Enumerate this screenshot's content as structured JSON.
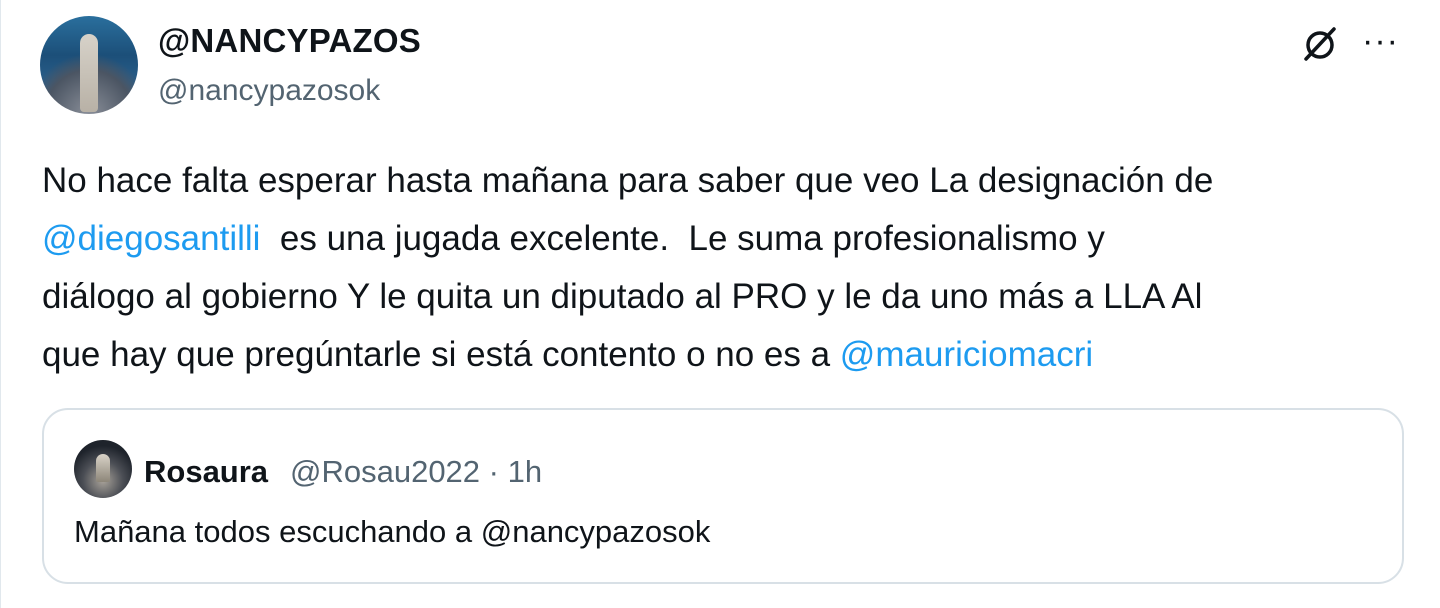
{
  "author": {
    "display_name": "@NANCYPAZOS",
    "handle": "@nancypazosok"
  },
  "icons": {
    "grok": "grok-slash-icon",
    "more": "more-options-icon",
    "more_glyph": "···"
  },
  "tweet": {
    "lines": [
      {
        "t1": "No hace falta esperar hasta mañana para saber que veo La designación de"
      },
      {
        "mention": "@diegosantilli",
        "t2": "  es una jugada excelente.  Le suma profesionalismo y"
      },
      {
        "t3": "diálogo al gobierno Y le quita un diputado al PRO y le da uno más a LLA Al"
      },
      {
        "t4": "que hay que pregúntarle si está contento o no es a ",
        "mention2": "@mauriciomacri"
      }
    ]
  },
  "quote": {
    "author": "Rosaura",
    "handle_time": "@Rosau2022 · 1h",
    "text": "Mañana todos escuchando a @nancypazosok"
  },
  "colors": {
    "mention": "#1d9bf0",
    "secondary_text": "#536471",
    "border": "#d8e0e6"
  }
}
